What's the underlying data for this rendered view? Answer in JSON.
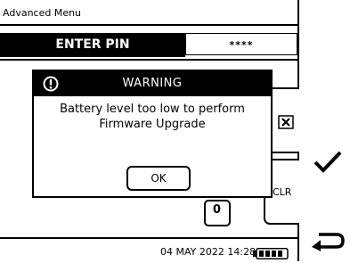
{
  "menu": {
    "title": "Advanced Menu"
  },
  "pin": {
    "label": "ENTER PIN",
    "value": "****"
  },
  "keypad": {
    "clear_label": "CLR",
    "zero_label": "0"
  },
  "dialog": {
    "title": "WARNING",
    "message_line1": "Battery level too low to perform",
    "message_line2": "Firmware Upgrade",
    "ok_label": "OK"
  },
  "status": {
    "datetime": "04 MAY 2022 14:28"
  },
  "icons": {
    "warning": "exclamation-circle-icon",
    "delete": "backspace-x-icon",
    "confirm": "checkmark-icon",
    "back": "return-arrow-icon",
    "battery": "battery-icon"
  },
  "colors": {
    "background": "#ffffff",
    "foreground": "#000000"
  }
}
